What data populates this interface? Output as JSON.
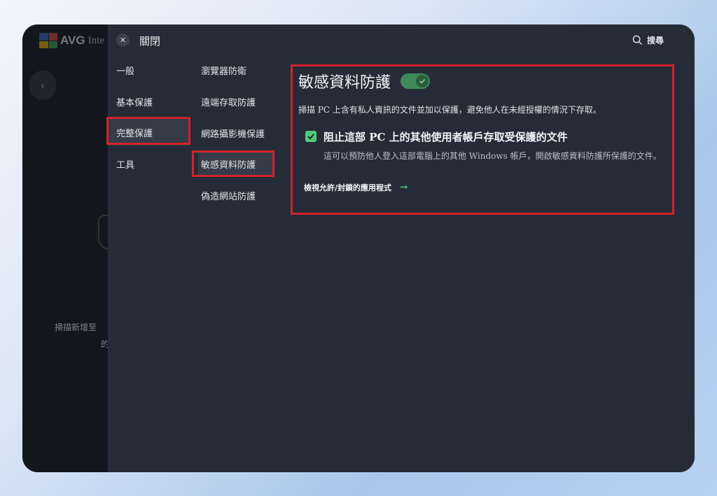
{
  "background_app": {
    "brand": "AVG",
    "brand_suffix": "Inte",
    "heading_partial": "",
    "text_partial": "掃描新增至",
    "text_partial2": "的"
  },
  "topbar": {
    "close_label": "關閉",
    "search_label": "搜尋"
  },
  "nav_primary": [
    {
      "label": "一般"
    },
    {
      "label": "基本保護"
    },
    {
      "label": "完整保護",
      "active": true
    },
    {
      "label": "工具"
    }
  ],
  "nav_secondary": [
    {
      "label": "瀏覽器防衛"
    },
    {
      "label": "遠端存取防護"
    },
    {
      "label": "網路攝影機保護"
    },
    {
      "label": "敏感資料防護",
      "active": true
    },
    {
      "label": "偽造網站防護"
    }
  ],
  "content": {
    "title": "敏感資料防護",
    "toggle_on": true,
    "description": "掃描 PC 上含有私人資訊的文件並加以保護，避免他人在未經授權的情況下存取。",
    "option": {
      "checked": true,
      "title": "阻止這部 PC 上的其他使用者帳戶存取受保護的文件",
      "description": "這可以預防他人登入這部電腦上的其他 Windows 帳戶，開啟敏感資料防護所保護的文件。"
    },
    "link_label": "檢視允許/封鎖的應用程式"
  },
  "colors": {
    "accent_green": "#4ecb79",
    "highlight_red": "#d2222d",
    "panel_bg": "#262c37"
  }
}
